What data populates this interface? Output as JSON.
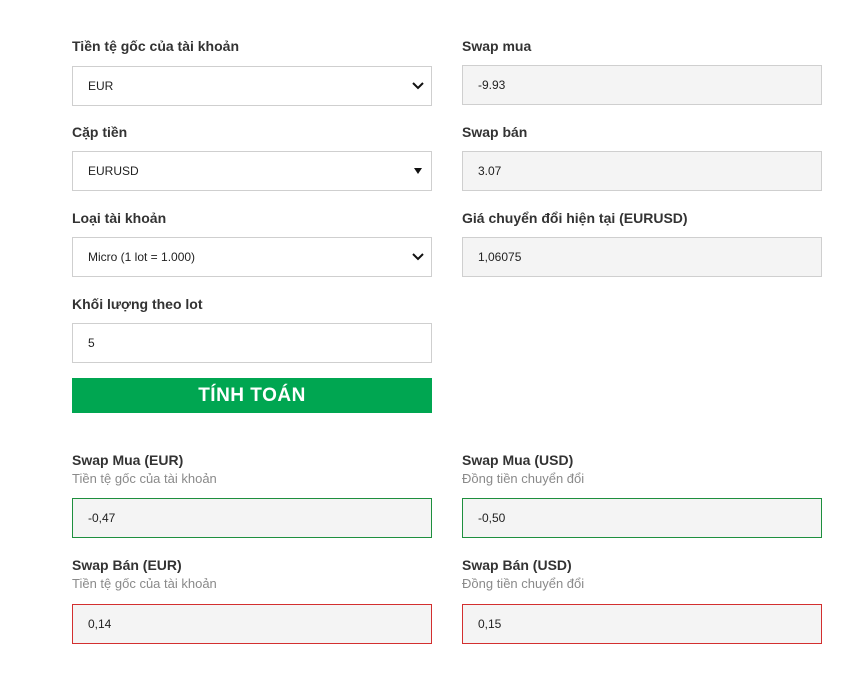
{
  "form": {
    "base_currency": {
      "label": "Tiền tệ gốc của tài khoản",
      "value": "EUR"
    },
    "pair": {
      "label": "Cặp tiền",
      "value": "EURUSD"
    },
    "account_type": {
      "label": "Loại tài khoản",
      "value": "Micro (1 lot = 1.000)"
    },
    "volume": {
      "label": "Khối lượng theo lot",
      "value": "5"
    },
    "swap_long": {
      "label": "Swap mua",
      "value": "-9.93"
    },
    "swap_short": {
      "label": "Swap bán",
      "value": "3.07"
    },
    "conversion_rate": {
      "label": "Giá chuyển đổi hiện tại (EURUSD)",
      "value": "1,06075"
    },
    "calculate_label": "TÍNH TOÁN"
  },
  "results": {
    "long_base": {
      "label": "Swap Mua (EUR)",
      "sublabel": "Tiền tệ gốc của tài khoản",
      "value": "-0,47"
    },
    "long_conv": {
      "label": "Swap Mua (USD)",
      "sublabel": "Đồng tiền chuyển đổi",
      "value": "-0,50"
    },
    "short_base": {
      "label": "Swap Bán (EUR)",
      "sublabel": "Tiền tệ gốc của tài khoản",
      "value": "0,14"
    },
    "short_conv": {
      "label": "Swap Bán (USD)",
      "sublabel": "Đồng tiền chuyển đổi",
      "value": "0,15"
    }
  },
  "colors": {
    "accent_green": "#00a651",
    "positive_border": "#1e8f3e",
    "negative_border": "#d32f2f"
  },
  "icons": {
    "select_arrow": "chevron-down-icon",
    "pair_arrow": "caret-down-icon"
  }
}
